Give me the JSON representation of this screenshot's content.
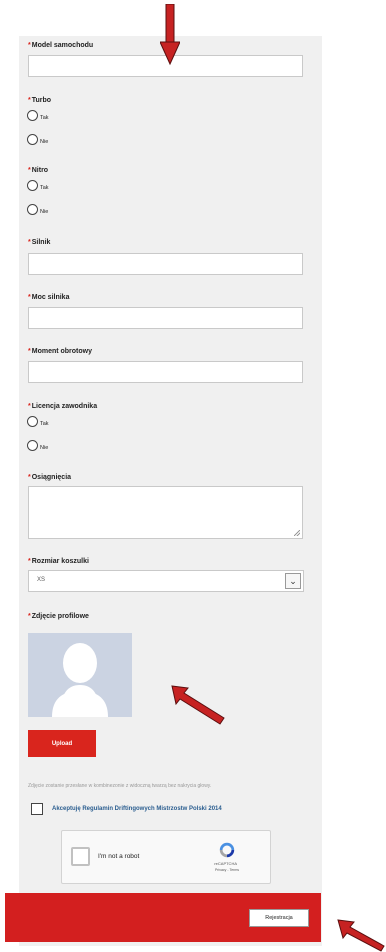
{
  "form": {
    "model_label": "Model samochodu",
    "turbo_label": "Turbo",
    "turbo_options": [
      "Tak",
      "Nie"
    ],
    "nitro_label": "Nitro",
    "nitro_options": [
      "Tak",
      "Nie"
    ],
    "silnik_label": "Silnik",
    "moc_label": "Moc silnika",
    "moment_label": "Moment obrotowy",
    "licencja_label": "Licencja zawodnika",
    "licencja_options": [
      "Tak",
      "Nie"
    ],
    "osiagniecia_label": "Osiągnięcia",
    "koszulka_label": "Rozmiar koszulki",
    "koszulka_value": "XS",
    "zdjecie_label": "Zdjęcie profilowe",
    "upload_label": "Upload",
    "note": "Zdjęcie zostanie przesłane w kombinezonie z widoczną twarzą bez nakrycia głowy.",
    "accept_label": "Akceptuję Regulamin Driftingowych Mistrzostw Polski 2014",
    "submit_label": "Rejestracja",
    "required_mark": "*"
  },
  "recaptcha": {
    "label": "I'm not a robot",
    "brand": "reCAPTCHA",
    "terms": "Privacy - Terms"
  },
  "colors": {
    "accent": "#d9251d",
    "footer": "#d31f1f",
    "link": "#2a5d8f",
    "panel": "#f0f0f0"
  }
}
